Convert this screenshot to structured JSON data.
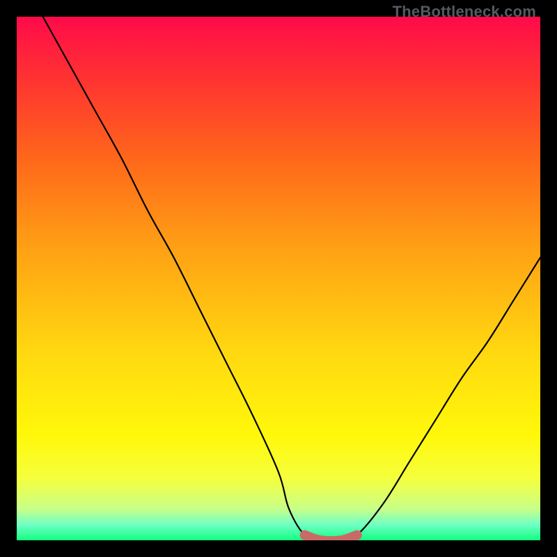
{
  "watermark": "TheBottleneck.com",
  "chart_data": {
    "type": "line",
    "title": "",
    "xlabel": "",
    "ylabel": "",
    "xlim": [
      0,
      100
    ],
    "ylim": [
      0,
      100
    ],
    "series": [
      {
        "name": "bottleneck-curve",
        "x": [
          5,
          10,
          15,
          20,
          25,
          30,
          35,
          40,
          45,
          50,
          52,
          55,
          58,
          62,
          65,
          70,
          75,
          80,
          85,
          90,
          95,
          100
        ],
        "values": [
          100,
          91,
          82,
          73,
          63,
          54,
          44,
          34,
          24,
          13,
          6,
          1,
          0,
          0,
          1,
          7,
          15,
          23,
          31,
          38,
          46,
          54
        ]
      }
    ],
    "highlight": {
      "name": "optimal-range",
      "x": [
        55,
        58,
        62,
        65
      ],
      "values": [
        1,
        0,
        0,
        1
      ]
    },
    "colors": {
      "curve": "#000000",
      "highlight": "#c96a66",
      "gradient_top": "#ff0a4a",
      "gradient_bottom": "#12ff80"
    }
  }
}
